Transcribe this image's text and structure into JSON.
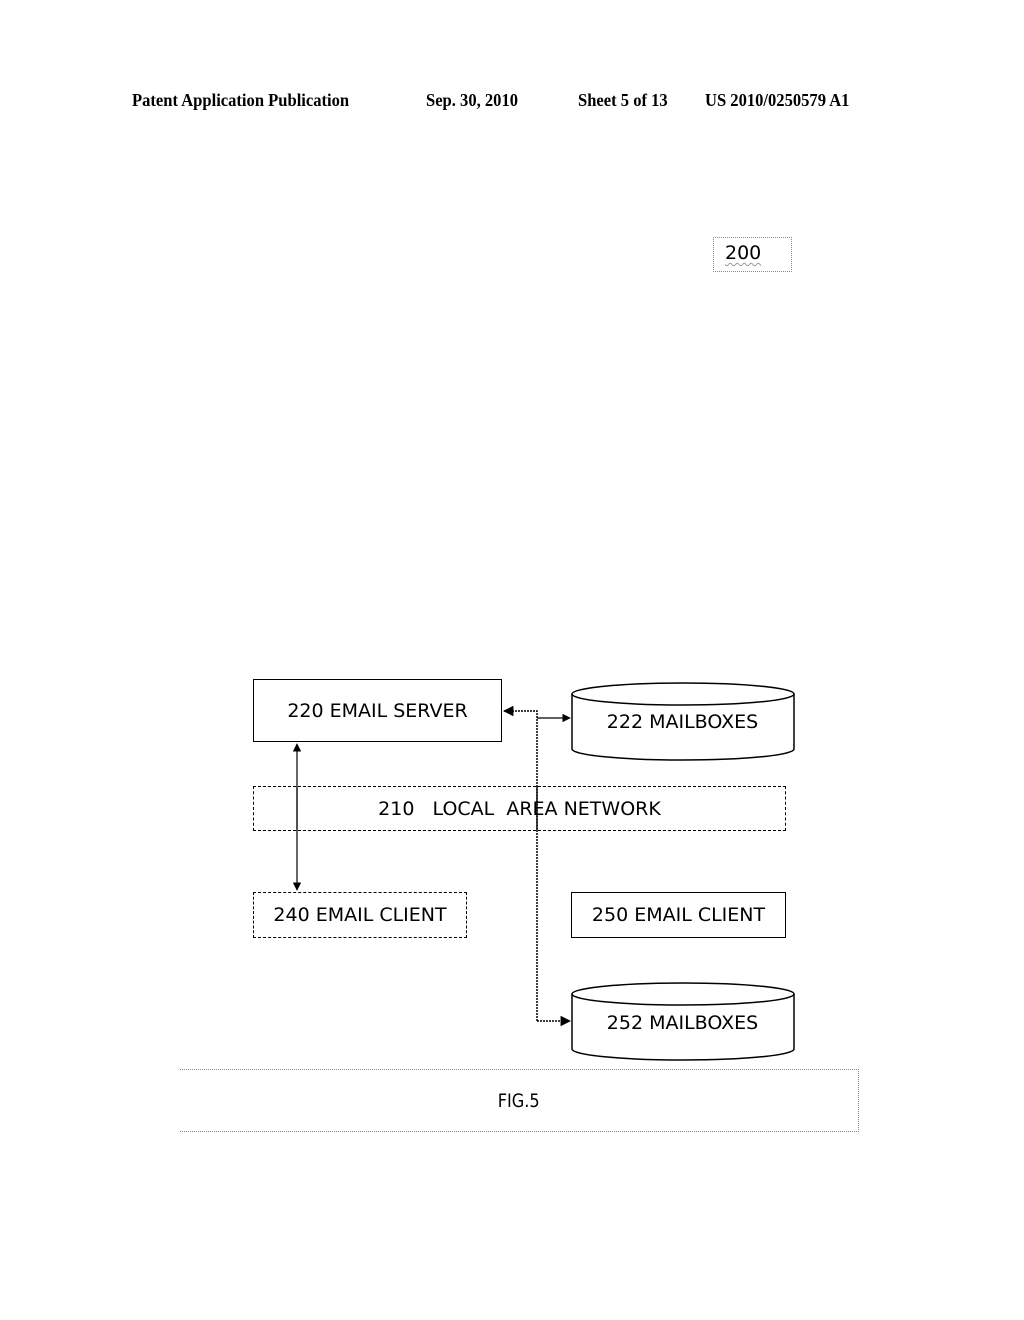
{
  "header": {
    "publication": "Patent Application Publication",
    "date": "Sep. 30, 2010",
    "sheet": "Sheet 5 of 13",
    "number": "US 2010/0250579 A1"
  },
  "diagram": {
    "reference_label": "200",
    "nodes": {
      "email_server": "220 EMAIL SERVER",
      "mailboxes_222": "222 MAILBOXES",
      "lan": "210   LOCAL  AREA NETWORK",
      "email_client_240": "240 EMAIL CLIENT",
      "email_client_250": "250 EMAIL CLIENT",
      "mailboxes_252": "252 MAILBOXES"
    },
    "edges": [
      {
        "from": "220 EMAIL SERVER",
        "to": "240 EMAIL CLIENT",
        "direction": "bidirectional"
      },
      {
        "from": "220 EMAIL SERVER",
        "to": "222 MAILBOXES",
        "direction": "bidirectional"
      },
      {
        "from": "220 EMAIL SERVER",
        "to": "252 MAILBOXES",
        "direction": "bidirectional"
      }
    ],
    "caption": "FIG.5"
  }
}
